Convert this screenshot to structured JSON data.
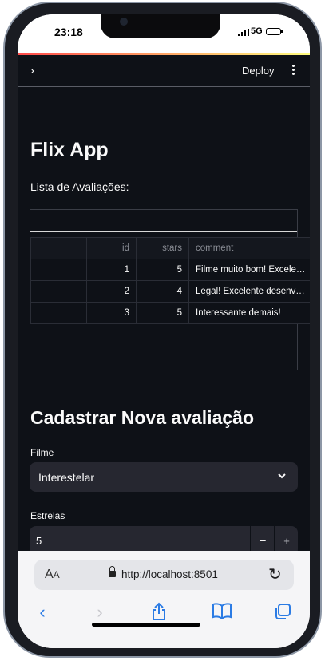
{
  "status": {
    "time": "23:18",
    "network": "5G"
  },
  "header": {
    "sidebar_toggle": "›",
    "deploy_label": "Deploy"
  },
  "page": {
    "title": "Flix App",
    "subtitle": "Lista de Avaliações:"
  },
  "table": {
    "columns": [
      "",
      "id",
      "stars",
      "comment",
      ""
    ],
    "rows": [
      {
        "id": "1",
        "stars": "5",
        "comment": "Filme muito bom! Excele…"
      },
      {
        "id": "2",
        "stars": "4",
        "comment": "Legal! Excelente desenv…"
      },
      {
        "id": "3",
        "stars": "5",
        "comment": "Interessante demais!"
      }
    ]
  },
  "form": {
    "heading": "Cadastrar Nova avaliação",
    "film_label": "Filme",
    "film_value": "Interestelar",
    "stars_label": "Estrelas",
    "stars_value": "5",
    "minus": "−",
    "plus": "+"
  },
  "browser": {
    "aa": "A",
    "aa_small": "A",
    "url": "http://localhost:8501",
    "reload": "↻",
    "back": "‹",
    "forward": "›"
  },
  "colors": {
    "app_bg": "#0e1117",
    "widget_bg": "#262730",
    "accent_decor_start": "#ff4b4b",
    "accent_decor_end": "#fffd80",
    "safari_blue": "#2b7be4"
  },
  "icons": [
    "chevron-right-icon",
    "kebab-menu-icon",
    "chevron-down-icon",
    "lock-icon",
    "reload-icon",
    "back-icon",
    "forward-icon",
    "share-icon",
    "bookmarks-icon",
    "tabs-icon"
  ]
}
